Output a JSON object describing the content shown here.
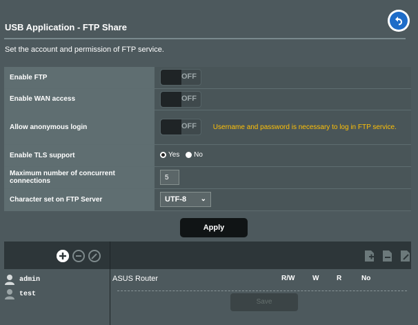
{
  "page": {
    "title": "USB Application - FTP Share",
    "description": "Set the account and permission of FTP service.",
    "back_icon": "back-arrow-icon"
  },
  "settings": {
    "enable_ftp": {
      "label": "Enable FTP",
      "state": "OFF"
    },
    "enable_wan": {
      "label": "Enable WAN access",
      "state": "OFF"
    },
    "allow_anon": {
      "label": "Allow anonymous login",
      "state": "OFF",
      "note": "Username and password is necessary to log in FTP service."
    },
    "tls": {
      "label": "Enable TLS support",
      "options": [
        "Yes",
        "No"
      ],
      "selected": "Yes"
    },
    "max_conn": {
      "label": "Maximum number of concurrent connections",
      "value": "5"
    },
    "charset": {
      "label": "Character set on FTP Server",
      "value": "UTF-8",
      "chevron": "chevron-down-icon"
    }
  },
  "apply_label": "Apply",
  "accounts": {
    "icons": [
      "add-user-icon",
      "remove-user-icon",
      "edit-user-icon"
    ],
    "folder_icons": [
      "add-folder-icon",
      "delete-folder-icon",
      "edit-folder-icon"
    ],
    "users": [
      "admin",
      "test"
    ]
  },
  "permissions": {
    "folder": "ASUS Router",
    "headers": [
      "R/W",
      "W",
      "R",
      "No"
    ],
    "save_label": "Save"
  },
  "colors": {
    "accent_note": "#ffc107",
    "back_button": "#1e6cc8"
  }
}
